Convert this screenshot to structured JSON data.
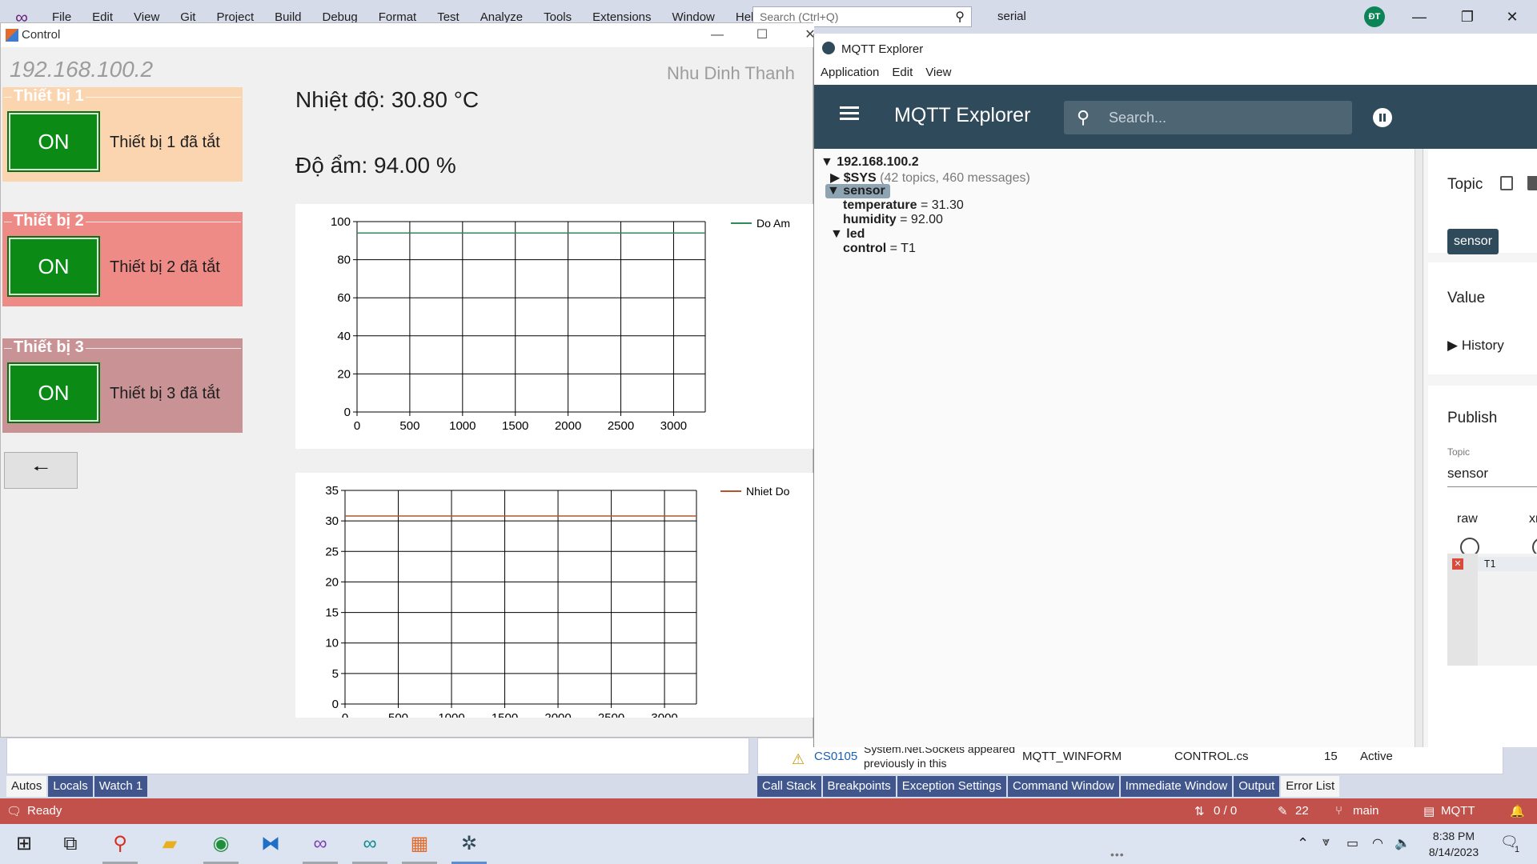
{
  "vs": {
    "menu": [
      "File",
      "Edit",
      "View",
      "Git",
      "Project",
      "Build",
      "Debug",
      "Format",
      "Test",
      "Analyze",
      "Tools",
      "Extensions",
      "Window",
      "Help"
    ],
    "search_placeholder": "Search (Ctrl+Q)",
    "solution_name": "serial",
    "avatar_initials": "ĐT",
    "error_row": {
      "code": "CS0105",
      "message": "System.Net.Sockets appeared previously in this",
      "project": "MQTT_WINFORM",
      "file": "CONTROL.cs",
      "line": "15",
      "state": "Active"
    },
    "tabs_left": [
      "Autos",
      "Locals",
      "Watch 1"
    ],
    "tabs_right": [
      "Call Stack",
      "Breakpoints",
      "Exception Settings",
      "Command Window",
      "Immediate Window",
      "Output",
      "Error List"
    ],
    "status": {
      "ready": "Ready",
      "sync": "0 / 0",
      "edits": "22",
      "branch": "main",
      "repo": "MQTT"
    }
  },
  "taskbar": {
    "time": "8:38 PM",
    "date": "8/14/2023",
    "notifications": "1"
  },
  "control": {
    "title": "Control",
    "ip": "192.168.100.2",
    "user_name": "Nhu Dinh Thanh",
    "temperature_text": "Nhiệt độ: 30.80 °C",
    "humidity_text": "Độ ẩm: 94.00 %",
    "devices": [
      {
        "title": "Thiết bị 1",
        "button": "ON",
        "status": "Thiết bị 1 đã tắt"
      },
      {
        "title": "Thiết bị 2",
        "button": "ON",
        "status": "Thiết bị 2 đã tắt"
      },
      {
        "title": "Thiết bị 3",
        "button": "ON",
        "status": "Thiết bị 3 đã tắt"
      }
    ],
    "back_label": "🠐"
  },
  "colors": {
    "humidity_line": "#2e8b57",
    "temperature_line": "#b5542c",
    "mqtt_primary": "#2f4a5a"
  },
  "chart_data": [
    {
      "type": "line",
      "title": "",
      "xlabel": "",
      "ylabel": "",
      "xlim": [
        0,
        3300
      ],
      "ylim": [
        0,
        100
      ],
      "xticks": [
        0,
        500,
        1000,
        1500,
        2000,
        2500,
        3000
      ],
      "yticks": [
        0,
        20,
        40,
        60,
        80,
        100
      ],
      "grid": true,
      "legend": "top-right",
      "series": [
        {
          "name": "Do Am",
          "x": [
            0,
            3300
          ],
          "y": [
            94,
            94
          ]
        }
      ]
    },
    {
      "type": "line",
      "title": "",
      "xlabel": "",
      "ylabel": "",
      "xlim": [
        0,
        3300
      ],
      "ylim": [
        0,
        35
      ],
      "xticks": [
        0,
        500,
        1000,
        1500,
        2000,
        2500,
        3000
      ],
      "yticks": [
        0,
        5,
        10,
        15,
        20,
        25,
        30,
        35
      ],
      "grid": true,
      "legend": "top-right",
      "series": [
        {
          "name": "Nhiet Do",
          "x": [
            0,
            3300
          ],
          "y": [
            30.8,
            30.8
          ]
        }
      ]
    }
  ],
  "mqtt": {
    "window_title": "MQTT Explorer",
    "menu": [
      "Application",
      "Edit",
      "View"
    ],
    "app_title": "MQTT Explorer",
    "search_placeholder": "Search...",
    "tree": {
      "root": "192.168.100.2",
      "sys": "$SYS",
      "sys_meta": "(42 topics, 460 messages)",
      "sensor": "sensor",
      "temperature_key": "temperature",
      "temperature_val": "= 31.30",
      "humidity_key": "humidity",
      "humidity_val": "= 92.00",
      "led": "led",
      "control_key": "control",
      "control_val": "= T1"
    },
    "side": {
      "topic_heading": "Topic",
      "topic_chip": "sensor",
      "value_heading": "Value",
      "history": "History",
      "publish_heading": "Publish",
      "publish_topic_label": "Topic",
      "publish_topic_value": "sensor",
      "format_raw": "raw",
      "format_xml": "xml",
      "editor_line": "T1"
    }
  }
}
